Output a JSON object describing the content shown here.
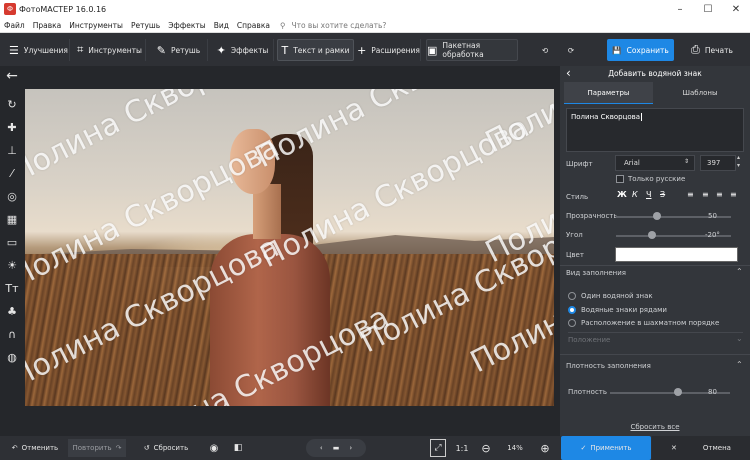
{
  "window": {
    "title": "ФотоМАСТЕР 16.0.16",
    "minimize": "–",
    "maximize": "☐",
    "close": "✕"
  },
  "menu": {
    "items": [
      "Файл",
      "Правка",
      "Инструменты",
      "Ретушь",
      "Эффекты",
      "Вид",
      "Справка"
    ],
    "search_placeholder": "Что вы хотите сделать?"
  },
  "toolbar": {
    "tabs": [
      {
        "label": "Улучшения",
        "icon": "sliders-icon"
      },
      {
        "label": "Инструменты",
        "icon": "crop-icon"
      },
      {
        "label": "Ретушь",
        "icon": "brush-icon"
      },
      {
        "label": "Эффекты",
        "icon": "magic-wand-icon"
      },
      {
        "label": "Текст и рамки",
        "icon": "text-icon"
      },
      {
        "label": "Расширения",
        "icon": "plus-icon"
      },
      {
        "label": "Пакетная обработка",
        "icon": "batch-icon"
      }
    ],
    "save_label": "Сохранить",
    "print_label": "Печать"
  },
  "watermark": {
    "text": "Полина Скворцова"
  },
  "panel": {
    "title": "Добавить водяной знак",
    "tab_params": "Параметры",
    "tab_templates": "Шаблоны",
    "text_value": "Полина Скворцова",
    "font_label": "Шрифт",
    "font_value": "Arial",
    "font_size": "397",
    "only_russian": "Только русские",
    "style_label": "Стиль",
    "opacity_label": "Прозрачность",
    "opacity_value": "50",
    "opacity_level": 0.5,
    "angle_label": "Угол",
    "angle_value": "-20°",
    "angle_level": 0.45,
    "color_label": "Цвет",
    "color_value": "#ffffff",
    "fill_section": "Вид заполнения",
    "fill_options": [
      "Один водяной знак",
      "Водяные знаки рядами",
      "Расположение в шахматном порядке"
    ],
    "fill_selected": 1,
    "position_label": "Положение",
    "density_section": "Плотность заполнения",
    "density_label": "Плотность",
    "density_value": "80",
    "density_level": 0.8,
    "reset_all": "Сбросить все",
    "apply_label": "Применить",
    "cancel_label": "Отмена"
  },
  "bottom": {
    "undo": "Отменить",
    "redo": "Повторить",
    "reset": "Сбросить",
    "ratio": "1:1",
    "zoom": "14%"
  },
  "colors": {
    "accent": "#1e88e5",
    "panel": "#33363b",
    "toolbar": "#2e3035"
  }
}
